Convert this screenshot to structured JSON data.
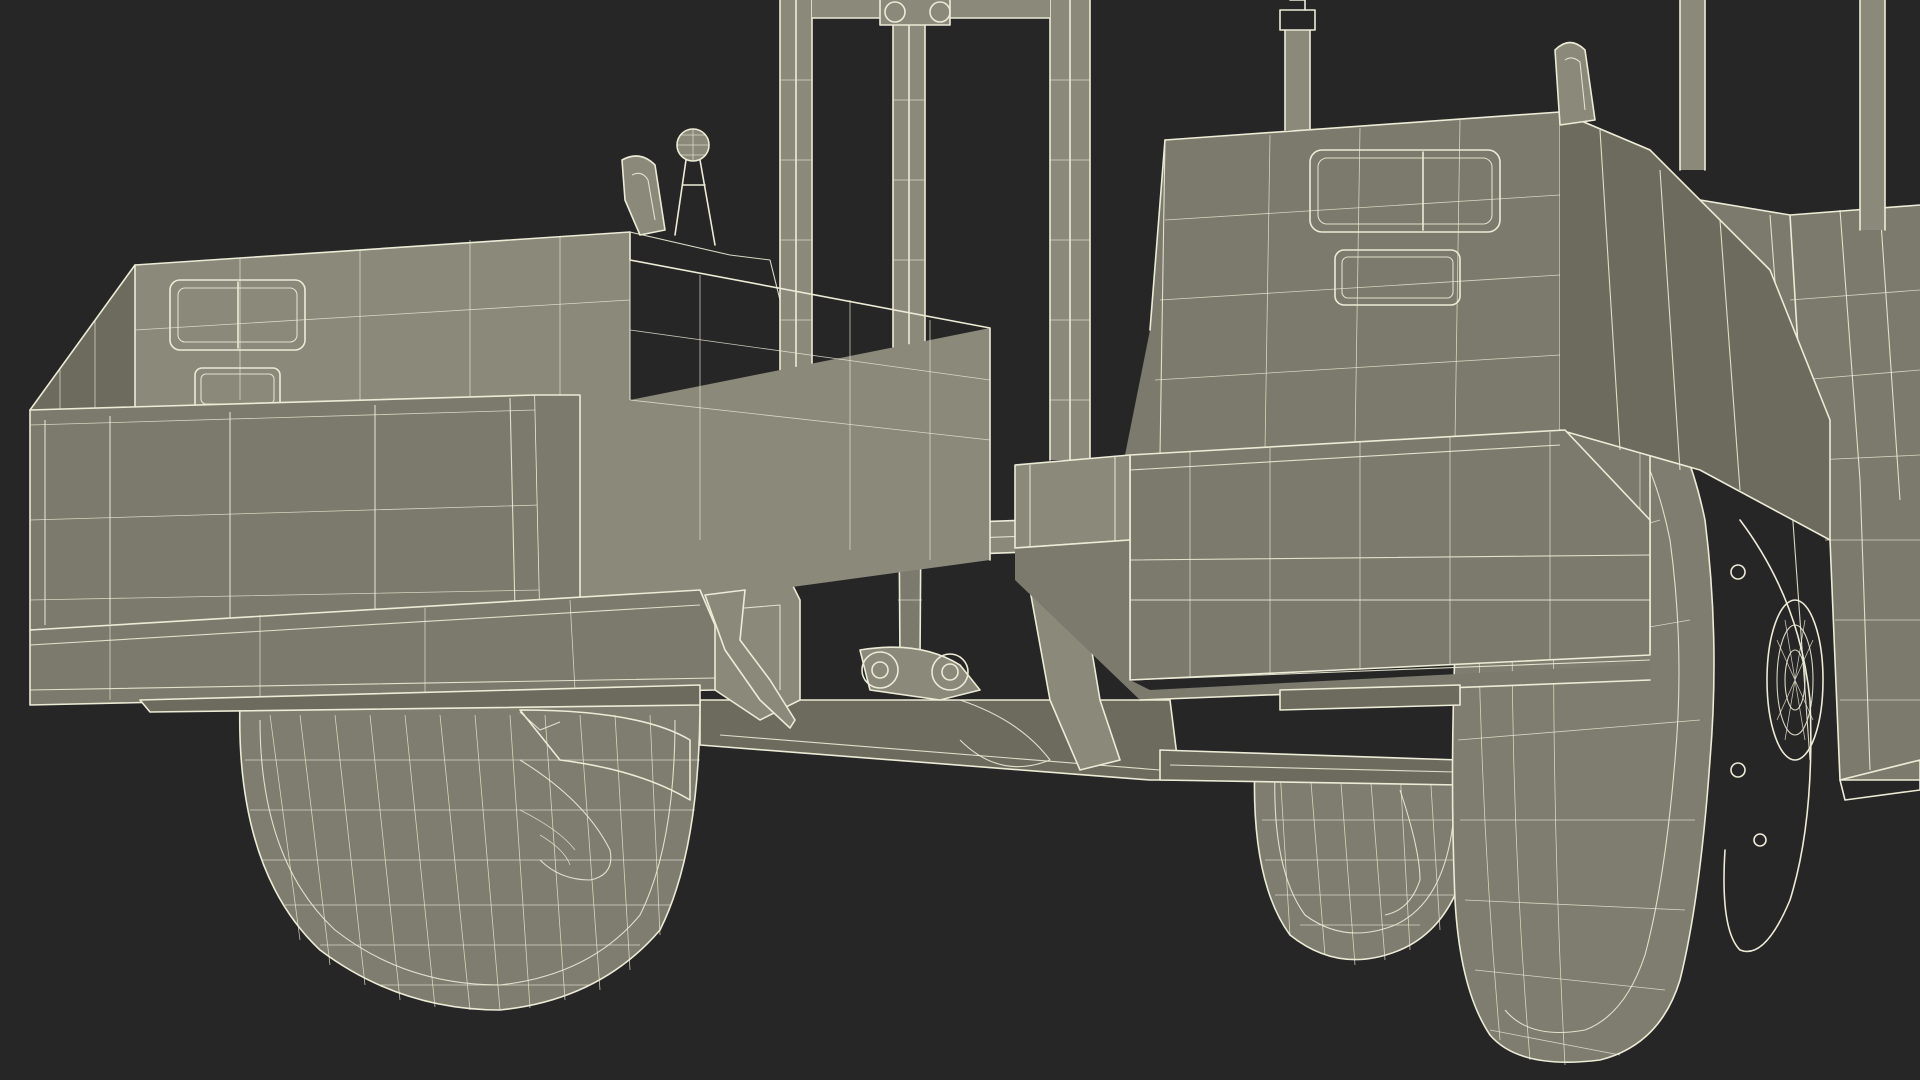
{
  "render": {
    "colors": {
      "background": "#262626",
      "body": "#7b7a6c",
      "body_shade": "#6c6b5e",
      "body_light": "#8a897a",
      "tire": "#7e7d6f",
      "wire": "#ecebd6"
    },
    "parts": [
      "left-cargo-box",
      "left-cargo-bumper",
      "left-front-wheel",
      "mast-left-post",
      "mast-right-post",
      "hydraulic-cylinder",
      "beacon-lamp",
      "right-fender-box",
      "right-bumper",
      "right-front-wheel",
      "rear-wheel",
      "chassis-floor"
    ]
  }
}
